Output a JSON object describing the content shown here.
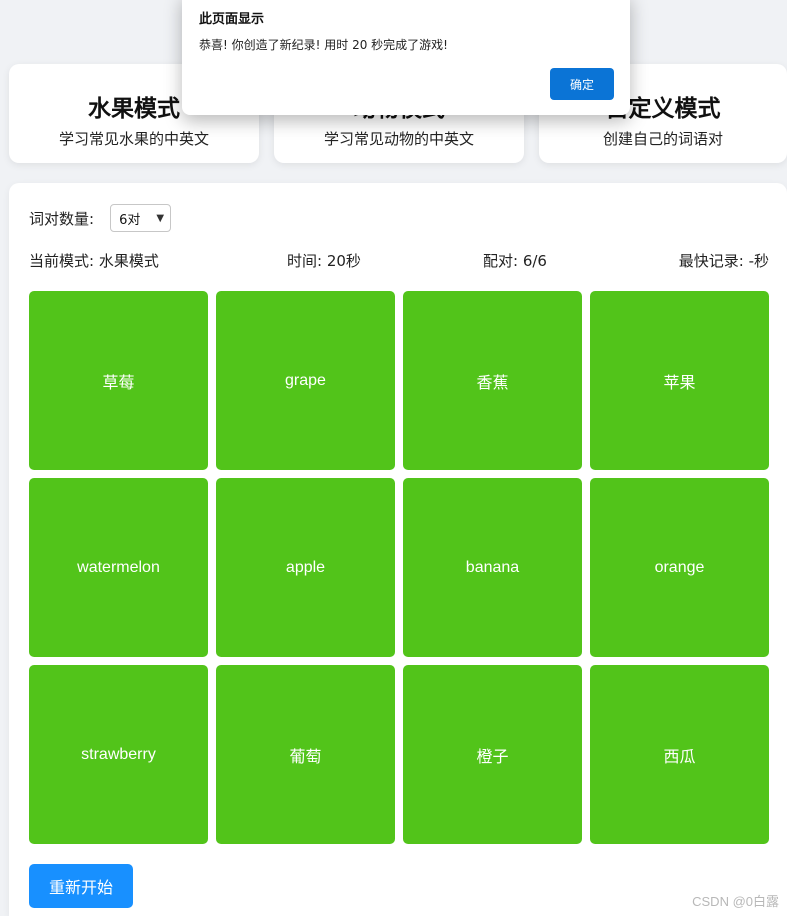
{
  "modes": [
    {
      "title": "水果模式",
      "desc": "学习常见水果的中英文"
    },
    {
      "title": "动物模式",
      "desc": "学习常见动物的中英文"
    },
    {
      "title": "自定义模式",
      "desc": "创建自己的词语对"
    }
  ],
  "settings": {
    "count_label": "词对数量:",
    "count_value": "6对"
  },
  "stats": {
    "mode": "当前模式: 水果模式",
    "time": "时间: 20秒",
    "pairs": "配对: 6/6",
    "best": "最快记录: -秒"
  },
  "tiles": [
    "草莓",
    "grape",
    "香蕉",
    "苹果",
    "watermelon",
    "apple",
    "banana",
    "orange",
    "strawberry",
    "葡萄",
    "橙子",
    "西瓜"
  ],
  "restart_label": "重新开始",
  "dialog": {
    "title": "此页面显示",
    "message": "恭喜! 你创造了新纪录! 用时 20 秒完成了游戏!",
    "ok_label": "确定"
  },
  "watermark": "CSDN @0白露",
  "colors": {
    "tile": "#52c41a",
    "primary": "#1890ff",
    "dialog_button": "#0b74d6"
  }
}
